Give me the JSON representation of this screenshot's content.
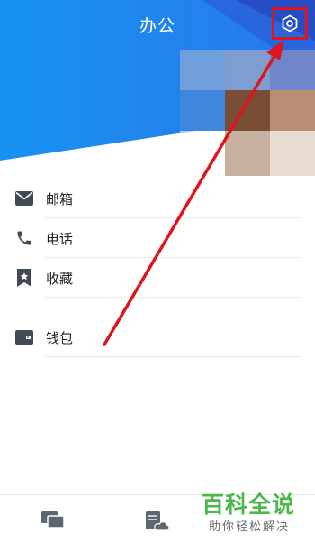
{
  "header": {
    "title": "办公",
    "settings_icon": "settings-hexagon-icon",
    "accent": "#1a8cf0"
  },
  "menu": {
    "items": [
      {
        "label": "邮箱",
        "icon": "mail-icon"
      },
      {
        "label": "电话",
        "icon": "phone-icon"
      },
      {
        "label": "收藏",
        "icon": "bookmark-icon"
      },
      {
        "label": "钱包",
        "icon": "wallet-icon"
      }
    ]
  },
  "bottom_bar": {
    "tabs": [
      {
        "icon": "chat-icon"
      },
      {
        "icon": "cloud-document-icon"
      }
    ]
  },
  "watermark": {
    "title": "百科全说",
    "subtitle": "助你轻松解决"
  },
  "annotation": {
    "color": "#e0141c"
  }
}
